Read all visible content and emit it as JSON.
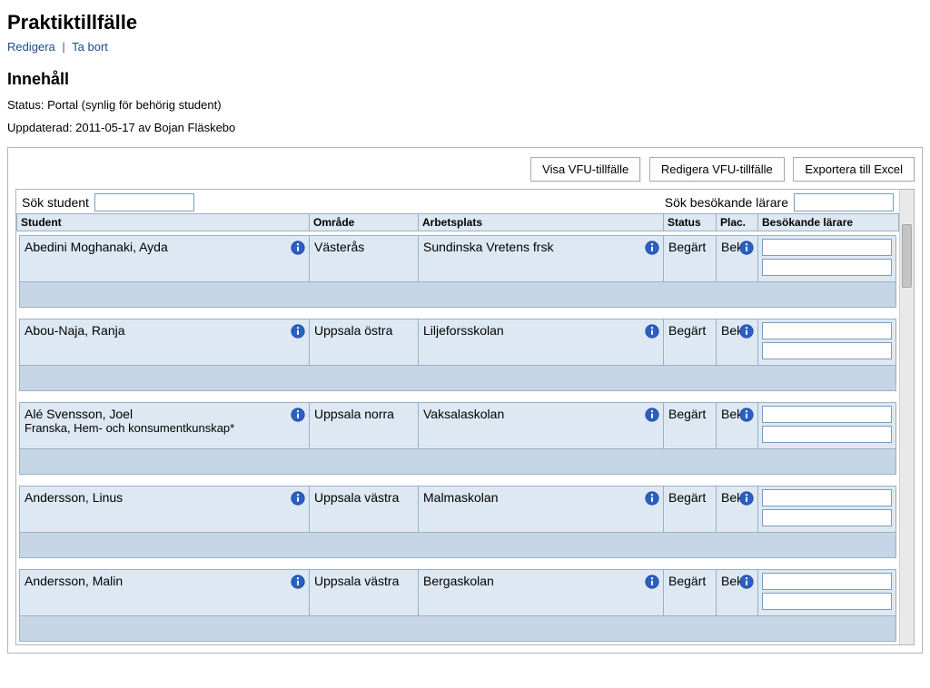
{
  "page_title": "Praktiktillfälle",
  "links": {
    "edit": "Redigera",
    "delete": "Ta bort"
  },
  "section_heading": "Innehåll",
  "status_line": "Status: Portal (synlig för behörig student)",
  "updated_line": "Uppdaterad: 2011-05-17 av Bojan Fläskebo",
  "toolbar": {
    "show_vfu": "Visa VFU-tillfälle",
    "edit_vfu": "Redigera VFU-tillfälle",
    "export_excel": "Exportera till Excel"
  },
  "search": {
    "student_label": "Sök student",
    "teacher_label": "Sök besökande lärare"
  },
  "columns": {
    "student": "Student",
    "omrade": "Område",
    "arbetsplats": "Arbetsplats",
    "status": "Status",
    "plac": "Plac.",
    "teacher": "Besökande lärare"
  },
  "rows": [
    {
      "student": "Abedini Moghanaki, Ayda",
      "student_sub": "",
      "omrade": "Västerås",
      "arbetsplats": "Sundinska Vretens frsk",
      "status": "Begärt",
      "plac": "Bekr."
    },
    {
      "student": "Abou-Naja, Ranja",
      "student_sub": "",
      "omrade": "Uppsala östra",
      "arbetsplats": "Liljeforsskolan",
      "status": "Begärt",
      "plac": "Bekr."
    },
    {
      "student": "Alé Svensson, Joel",
      "student_sub": "Franska, Hem- och konsumentkunskap*",
      "omrade": "Uppsala norra",
      "arbetsplats": "Vaksalaskolan",
      "status": "Begärt",
      "plac": "Bekr."
    },
    {
      "student": "Andersson, Linus",
      "student_sub": "",
      "omrade": "Uppsala västra",
      "arbetsplats": "Malmaskolan",
      "status": "Begärt",
      "plac": "Bekr."
    },
    {
      "student": "Andersson, Malin",
      "student_sub": "",
      "omrade": "Uppsala västra",
      "arbetsplats": "Bergaskolan",
      "status": "Begärt",
      "plac": "Bekr."
    }
  ]
}
